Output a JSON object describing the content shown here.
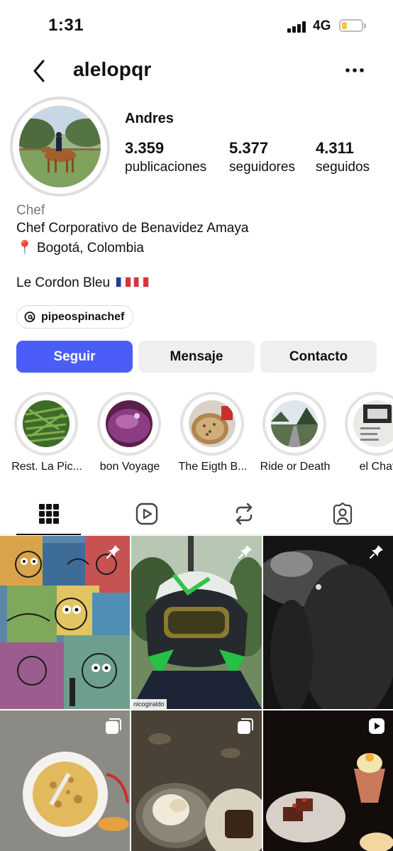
{
  "status_bar": {
    "time": "1:31",
    "network": "4G"
  },
  "header": {
    "username": "alelopqr"
  },
  "profile": {
    "display_name": "Andres",
    "stats": [
      {
        "value": "3.359",
        "label": "publicaciones"
      },
      {
        "value": "5.377",
        "label": "seguidores"
      },
      {
        "value": "4.311",
        "label": "seguidos"
      }
    ],
    "category": "Chef",
    "bio_line1": "Chef Corporativo de Benavidez Amaya",
    "location_pin": "📍",
    "location": "Bogotá, Colombia",
    "bio_line3": "Le Cordon Bleu",
    "threads_handle": "pipeospinachef"
  },
  "actions": {
    "follow": "Seguir",
    "message": "Mensaje",
    "contact": "Contacto"
  },
  "highlights": [
    {
      "label": "Rest. La Pic..."
    },
    {
      "label": "bon Voyage"
    },
    {
      "label": "The Eigth B..."
    },
    {
      "label": "Ride or Death"
    },
    {
      "label": "el Chat"
    }
  ],
  "tabs": [
    "grid",
    "reels",
    "reposts",
    "tagged"
  ],
  "posts": [
    {
      "badge": "pin-icon"
    },
    {
      "badge": "pin-icon",
      "caption": "nicogiraldo"
    },
    {
      "badge": "pin-icon"
    },
    {
      "badge": "carousel-icon"
    },
    {
      "badge": "carousel-icon"
    },
    {
      "badge": "reel-icon"
    }
  ],
  "colors": {
    "accent": "#4a5df9",
    "secondary_button": "#efeff1"
  }
}
